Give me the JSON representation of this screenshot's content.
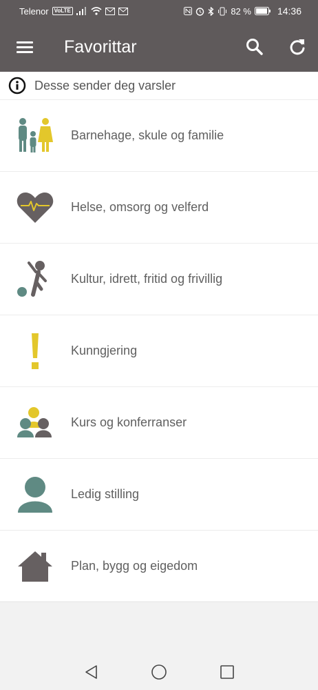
{
  "statusbar": {
    "carrier": "Telenor",
    "volte": "VoLTE",
    "battery": "82 %",
    "time": "14:36"
  },
  "appbar": {
    "title": "Favorittar",
    "menu_icon": "menu-icon",
    "search_icon": "search-icon",
    "refresh_icon": "refresh-icon"
  },
  "notice": {
    "icon": "info-icon",
    "text": "Desse sender deg varsler"
  },
  "categories": [
    {
      "label": "Barnehage, skule og familie",
      "icon": "family-icon"
    },
    {
      "label": "Helse, omsorg og velferd",
      "icon": "heart-pulse-icon"
    },
    {
      "label": "Kultur, idrett, fritid og frivillig",
      "icon": "sport-person-icon"
    },
    {
      "label": "Kunngjering",
      "icon": "exclamation-icon"
    },
    {
      "label": "Kurs og konferranser",
      "icon": "group-people-icon"
    },
    {
      "label": "Ledig stilling",
      "icon": "person-icon"
    },
    {
      "label": "Plan, bygg og eigedom",
      "icon": "house-icon"
    }
  ],
  "colors": {
    "appbar": "#5f5a5b",
    "teal": "#5f8a83",
    "yellow": "#e3c72b",
    "grey_dark": "#666061",
    "text": "#5f5f5f"
  },
  "navbar": {
    "back_icon": "back-triangle-icon",
    "home_icon": "home-circle-icon",
    "recents_icon": "recents-square-icon"
  }
}
